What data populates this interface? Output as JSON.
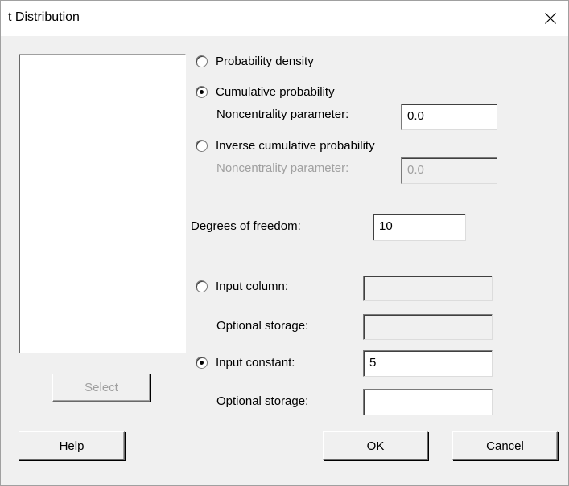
{
  "window": {
    "title": "t Distribution",
    "close_icon": "close-icon"
  },
  "options": {
    "probability_density": "Probability density",
    "cumulative_probability": "Cumulative probability",
    "cumulative_noncentrality_label": "Noncentrality parameter:",
    "cumulative_noncentrality_value": "0.0",
    "inverse_cumulative_probability": "Inverse cumulative probability",
    "inverse_noncentrality_label": "Noncentrality parameter:",
    "inverse_noncentrality_value": "0.0",
    "selected": "Cumulative probability"
  },
  "degrees_of_freedom": {
    "label": "Degrees of freedom:",
    "value": "10"
  },
  "input": {
    "column_label": "Input column:",
    "column_value": "",
    "column_storage_label": "Optional storage:",
    "column_storage_value": "",
    "constant_label": "Input constant:",
    "constant_value": "5",
    "constant_storage_label": "Optional storage:",
    "constant_storage_value": "",
    "selected": "Input constant"
  },
  "buttons": {
    "select": "Select",
    "help": "Help",
    "ok": "OK",
    "cancel": "Cancel"
  }
}
